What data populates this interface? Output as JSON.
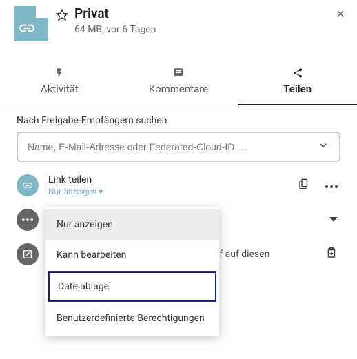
{
  "header": {
    "title": "Privat",
    "meta": "64 MB, vor 6 Tagen"
  },
  "tabs": {
    "activity": "Aktivität",
    "comments": "Kommentare",
    "share": "Teilen"
  },
  "search": {
    "label": "Nach Freigabe-Empfängern suchen",
    "placeholder": "Name, E-Mail-Adresse oder Federated-Cloud-ID …"
  },
  "linkShare": {
    "title": "Link teilen",
    "sub": "Nur anzeigen ▾"
  },
  "dropdown": {
    "opt1": "Nur anzeigen",
    "opt2": "Kann bearbeiten",
    "opt3": "Dateiablage",
    "opt4": "Benutzerdefinierte Berechtigungen"
  },
  "obscured": "iff auf diesen"
}
